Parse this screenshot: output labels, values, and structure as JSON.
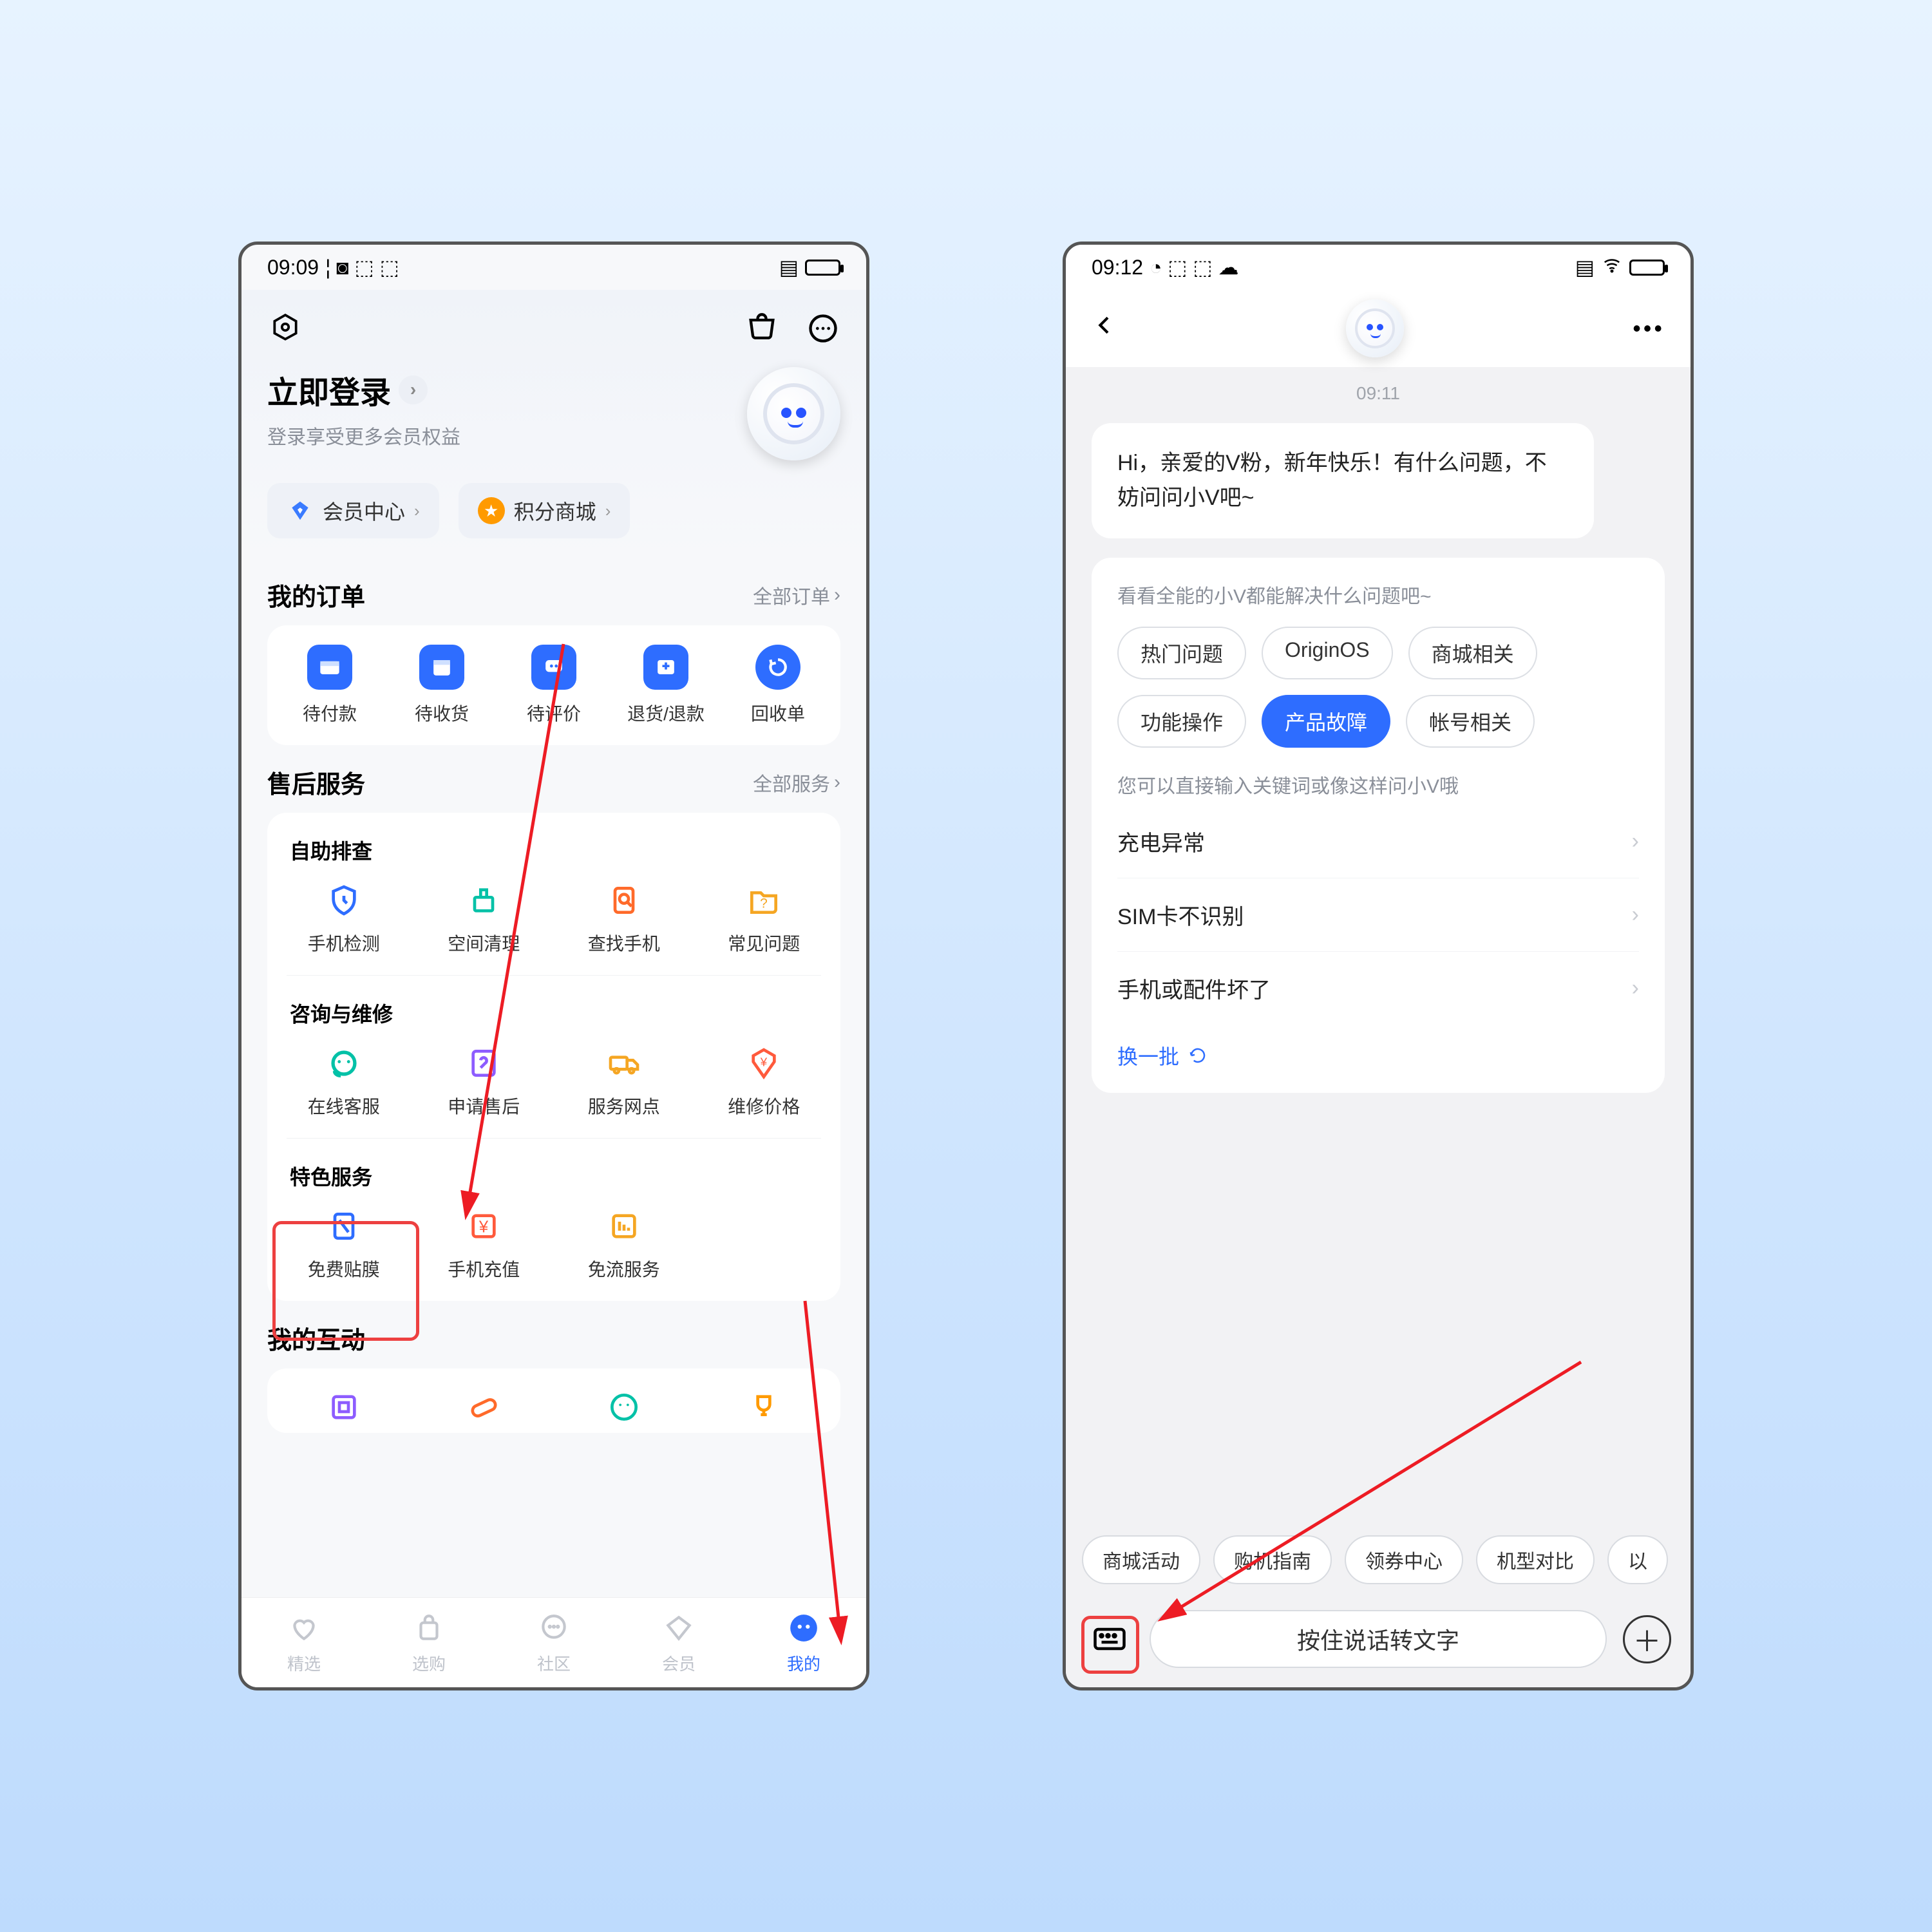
{
  "left": {
    "status": {
      "time": "09:09"
    },
    "login": {
      "title": "立即登录",
      "subtitle": "登录享受更多会员权益"
    },
    "pills": {
      "member": "会员中心",
      "points": "积分商城"
    },
    "orders": {
      "title": "我的订单",
      "more": "全部订单",
      "items": [
        "待付款",
        "待收货",
        "待评价",
        "退货/退款",
        "回收单"
      ]
    },
    "service": {
      "title": "售后服务",
      "more": "全部服务",
      "g1_title": "自助排查",
      "g1": [
        "手机检测",
        "空间清理",
        "查找手机",
        "常见问题"
      ],
      "g2_title": "咨询与维修",
      "g2": [
        "在线客服",
        "申请售后",
        "服务网点",
        "维修价格"
      ],
      "g3_title": "特色服务",
      "g3": [
        "免费贴膜",
        "手机充值",
        "免流服务"
      ]
    },
    "interact": {
      "title": "我的互动"
    },
    "tabs": [
      "精选",
      "选购",
      "社区",
      "会员",
      "我的"
    ]
  },
  "right": {
    "status": {
      "time": "09:12"
    },
    "chat_time": "09:11",
    "greeting": "Hi，亲爱的V粉，新年快乐！有什么问题，不妨问问小V吧~",
    "panel": {
      "hint": "看看全能的小V都能解决什么问题吧~",
      "chips": [
        "热门问题",
        "OriginOS",
        "商城相关",
        "功能操作",
        "产品故障",
        "帐号相关"
      ],
      "active_chip": 4,
      "hint2": "您可以直接输入关键词或像这样问小V哦",
      "list": [
        "充电异常",
        "SIM卡不识别",
        "手机或配件坏了"
      ],
      "refresh": "换一批"
    },
    "quick": [
      "商城活动",
      "购机指南",
      "领券中心",
      "机型对比",
      "以"
    ],
    "voice": "按住说话转文字"
  }
}
